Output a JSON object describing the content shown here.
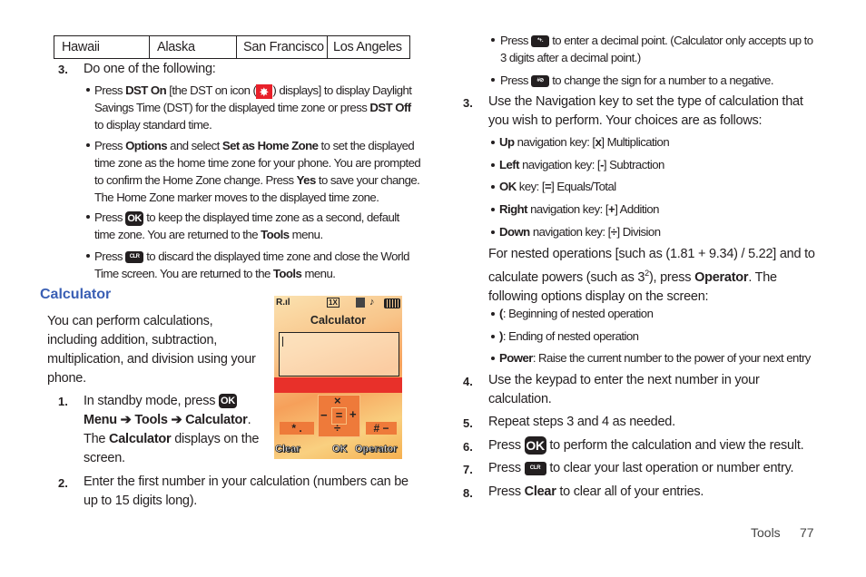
{
  "table": {
    "cells": [
      "Hawaii",
      "Alaska",
      "San Francisco",
      "Los Angeles"
    ]
  },
  "left": {
    "step3": {
      "num": "3.",
      "text": "Do one of the following:"
    },
    "bullets": [
      {
        "pre": "Press ",
        "b1": "DST On",
        "mid1": " [the DST on icon (",
        "icon": "dst-on-icon",
        "mid2": ") displays] to display Daylight Savings Time (DST) for the displayed time zone or press ",
        "b2": "DST Off",
        "post": " to display standard time."
      },
      {
        "pre": "Press ",
        "b1": "Options",
        "mid1": " and select ",
        "b2": "Set as Home Zone",
        "mid2": " to set the displayed time zone as the home time zone for your phone. You are prompted to confirm the Home Zone change. Press ",
        "b3": "Yes",
        "post": " to save your change. The Home Zone marker moves to the displayed time zone."
      },
      {
        "pre": "Press ",
        "icon": "ok-key-icon",
        "mid1": " to keep the displayed time zone as a second, default time zone. You are returned to the ",
        "b1": "Tools",
        "post": " menu."
      },
      {
        "pre": "Press ",
        "icon": "clr-key-icon",
        "mid1": " to discard the displayed time zone and close the World Time screen. You are returned to the ",
        "b1": "Tools",
        "post": " menu."
      }
    ],
    "heading": "Calculator",
    "intro": "You can perform calculations, including addition, subtraction, multiplication, and division using your phone.",
    "step1": {
      "num": "1.",
      "pre": "In standby mode, press ",
      "path1": "Menu",
      "arrow": " ➔ ",
      "path2": "Tools",
      "path3": "Calculator",
      "mid": ". The ",
      "b": "Calculator",
      "post": " displays on the screen."
    },
    "step2": {
      "num": "2.",
      "text": "Enter the first number in your calculation (numbers can be up to 15 digits long)."
    }
  },
  "phone": {
    "signal": "R.ıl",
    "network": "1X",
    "title": "Calculator",
    "pad": {
      "up": "×",
      "left": "−",
      "center": "=",
      "right": "+",
      "down": "÷"
    },
    "left_key": "* .",
    "right_key": "# −",
    "softkeys": {
      "left": "Clear",
      "center": "OK",
      "right": "Operator"
    }
  },
  "keys": {
    "ok": "OK",
    "clr": "CLR",
    "decimal": "*+.",
    "sign": "#⊘"
  },
  "right": {
    "bullets_top": [
      {
        "pre": "Press ",
        "icon": "decimal-key-icon",
        "post": " to enter a decimal point. (Calculator only accepts up to 3 digits after a decimal point.)"
      },
      {
        "pre": "Press ",
        "icon": "sign-key-icon",
        "post": " to change the sign for a number to a negative."
      }
    ],
    "step3": {
      "num": "3.",
      "text": "Use the Navigation key to set the type of calculation that you wish to perform. Your choices are as follows:"
    },
    "nav": [
      {
        "b": "Up",
        "mid": " navigation key: [",
        "sym": "x",
        "post": "] Multiplication"
      },
      {
        "b": "Left",
        "mid": " navigation key: [",
        "sym": "-",
        "post": "] Subtraction"
      },
      {
        "b": "OK",
        "mid": " key: [",
        "sym": "=",
        "post": "] Equals/Total"
      },
      {
        "b": "Right",
        "mid": " navigation key: [",
        "sym": "+",
        "post": "] Addition"
      },
      {
        "b": "Down",
        "mid": " navigation key: [",
        "sym": "÷",
        "post": "] Division"
      }
    ],
    "nested": {
      "pre": "For nested operations [such as (1.81 + 9.34) / 5.22] and to calculate powers (such as 3",
      "sup": "2",
      "mid": "), press ",
      "b": "Operator",
      "post": ". The following options display on the screen:"
    },
    "options": [
      {
        "b": "(",
        "post": ": Beginning of nested operation"
      },
      {
        "b": ")",
        "post": ": Ending of nested operation"
      },
      {
        "b": "Power",
        "post": ": Raise the current number to the power of your next entry"
      }
    ],
    "step4": {
      "num": "4.",
      "text": "Use the keypad to enter the next number in your calculation."
    },
    "step5": {
      "num": "5.",
      "text": "Repeat steps 3 and 4 as needed."
    },
    "step6": {
      "num": "6.",
      "pre": "Press ",
      "post": " to perform the calculation and view the result."
    },
    "step7": {
      "num": "7.",
      "pre": "Press ",
      "post": " to clear your last operation or number entry."
    },
    "step8": {
      "num": "8.",
      "pre": "Press ",
      "b": "Clear",
      "post": " to clear all of your entries."
    }
  },
  "footer": {
    "section": "Tools",
    "page": "77"
  }
}
